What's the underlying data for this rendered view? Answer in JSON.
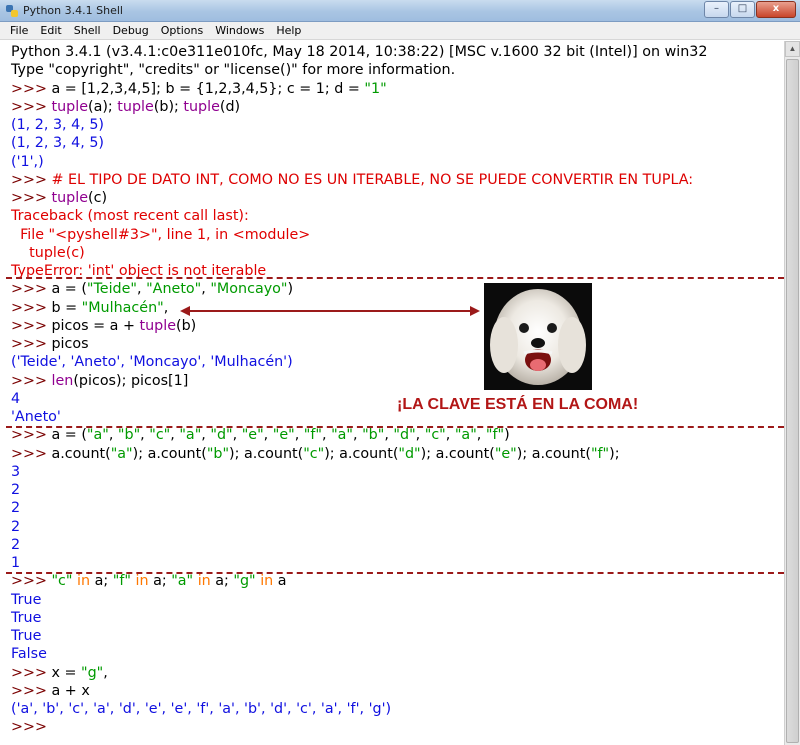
{
  "window": {
    "title": "Python 3.4.1 Shell",
    "buttons": {
      "minimize": "–",
      "maximize": "□",
      "close": "x"
    }
  },
  "menu": [
    "File",
    "Edit",
    "Shell",
    "Debug",
    "Options",
    "Windows",
    "Help"
  ],
  "annotation": "¡LA CLAVE ESTÁ EN LA COMA!",
  "photo_alt": "white dog",
  "colors": {
    "prompt": "#7a0000",
    "string": "#009a00",
    "builtin": "#900090",
    "output": "#1010e0",
    "error": "#e00000",
    "keyword": "#ff7700",
    "separator": "#9b1a1a"
  },
  "lines": [
    {
      "segs": [
        [
          "Python 3.4.1 (v3.4.1:c0e311e010fc, May 18 2014, 10:38:22) [MSC v.1600 32 bit (Intel)] on win32",
          ""
        ]
      ]
    },
    {
      "segs": [
        [
          "Type \"copyright\", \"credits\" or \"license()\" for more information.",
          ""
        ]
      ]
    },
    {
      "segs": [
        [
          ">>> ",
          "prompt"
        ],
        [
          "a = [1,2,3,4,5]; b = {1,2,3,4,5}; c = 1; d = ",
          ""
        ],
        [
          "\"1\"",
          "string"
        ]
      ]
    },
    {
      "segs": [
        [
          ">>> ",
          "prompt"
        ],
        [
          "tuple",
          "builtin"
        ],
        [
          "(a); ",
          ""
        ],
        [
          "tuple",
          "builtin"
        ],
        [
          "(b); ",
          ""
        ],
        [
          "tuple",
          "builtin"
        ],
        [
          "(d)",
          ""
        ]
      ]
    },
    {
      "segs": [
        [
          "(1, 2, 3, 4, 5)",
          "output"
        ]
      ]
    },
    {
      "segs": [
        [
          "(1, 2, 3, 4, 5)",
          "output"
        ]
      ]
    },
    {
      "segs": [
        [
          "('1',)",
          "output"
        ]
      ]
    },
    {
      "segs": [
        [
          ">>> ",
          "prompt"
        ],
        [
          "# EL TIPO DE DATO INT, COMO NO ES UN ITERABLE, NO SE PUEDE CONVERTIR EN TUPLA:",
          "comment"
        ]
      ]
    },
    {
      "segs": [
        [
          ">>> ",
          "prompt"
        ],
        [
          "tuple",
          "builtin"
        ],
        [
          "(c)",
          ""
        ]
      ]
    },
    {
      "segs": [
        [
          "Traceback (most recent call last):",
          "error"
        ]
      ]
    },
    {
      "segs": [
        [
          "  File \"<pyshell#3>\", line 1, in <module>",
          "error"
        ]
      ]
    },
    {
      "segs": [
        [
          "    tuple(c)",
          "error"
        ]
      ]
    },
    {
      "segs": [
        [
          "TypeError: 'int' object is not iterable",
          "error"
        ]
      ]
    },
    {
      "segs": [
        [
          ">>> ",
          "prompt"
        ],
        [
          "a = (",
          ""
        ],
        [
          "\"Teide\"",
          "string"
        ],
        [
          ", ",
          ""
        ],
        [
          "\"Aneto\"",
          "string"
        ],
        [
          ", ",
          ""
        ],
        [
          "\"Moncayo\"",
          "string"
        ],
        [
          ")",
          ""
        ]
      ]
    },
    {
      "segs": [
        [
          ">>> ",
          "prompt"
        ],
        [
          "b = ",
          ""
        ],
        [
          "\"Mulhacén\"",
          "string"
        ],
        [
          ",",
          ""
        ]
      ]
    },
    {
      "segs": [
        [
          ">>> ",
          "prompt"
        ],
        [
          "picos = a + ",
          ""
        ],
        [
          "tuple",
          "builtin"
        ],
        [
          "(b)",
          ""
        ]
      ]
    },
    {
      "segs": [
        [
          ">>> ",
          "prompt"
        ],
        [
          "picos",
          ""
        ]
      ]
    },
    {
      "segs": [
        [
          "('Teide', 'Aneto', 'Moncayo', 'Mulhacén')",
          "output"
        ]
      ]
    },
    {
      "segs": [
        [
          ">>> ",
          "prompt"
        ],
        [
          "len",
          "builtin"
        ],
        [
          "(picos); picos[1]",
          ""
        ]
      ]
    },
    {
      "segs": [
        [
          "4",
          "output"
        ]
      ]
    },
    {
      "segs": [
        [
          "'Aneto'",
          "output"
        ]
      ]
    },
    {
      "segs": [
        [
          ">>> ",
          "prompt"
        ],
        [
          "a = (",
          ""
        ],
        [
          "\"a\"",
          "string"
        ],
        [
          ", ",
          ""
        ],
        [
          "\"b\"",
          "string"
        ],
        [
          ", ",
          ""
        ],
        [
          "\"c\"",
          "string"
        ],
        [
          ", ",
          ""
        ],
        [
          "\"a\"",
          "string"
        ],
        [
          ", ",
          ""
        ],
        [
          "\"d\"",
          "string"
        ],
        [
          ", ",
          ""
        ],
        [
          "\"e\"",
          "string"
        ],
        [
          ", ",
          ""
        ],
        [
          "\"e\"",
          "string"
        ],
        [
          ", ",
          ""
        ],
        [
          "\"f\"",
          "string"
        ],
        [
          ", ",
          ""
        ],
        [
          "\"a\"",
          "string"
        ],
        [
          ", ",
          ""
        ],
        [
          "\"b\"",
          "string"
        ],
        [
          ", ",
          ""
        ],
        [
          "\"d\"",
          "string"
        ],
        [
          ", ",
          ""
        ],
        [
          "\"c\"",
          "string"
        ],
        [
          ", ",
          ""
        ],
        [
          "\"a\"",
          "string"
        ],
        [
          ", ",
          ""
        ],
        [
          "\"f\"",
          "string"
        ],
        [
          ")",
          ""
        ]
      ]
    },
    {
      "segs": [
        [
          ">>> ",
          "prompt"
        ],
        [
          "a.count(",
          ""
        ],
        [
          "\"a\"",
          "string"
        ],
        [
          "); a.count(",
          ""
        ],
        [
          "\"b\"",
          "string"
        ],
        [
          "); a.count(",
          ""
        ],
        [
          "\"c\"",
          "string"
        ],
        [
          "); a.count(",
          ""
        ],
        [
          "\"d\"",
          "string"
        ],
        [
          "); a.count(",
          ""
        ],
        [
          "\"e\"",
          "string"
        ],
        [
          "); a.count(",
          ""
        ],
        [
          "\"f\"",
          "string"
        ],
        [
          ");",
          ""
        ]
      ]
    },
    {
      "segs": [
        [
          "3",
          "output"
        ]
      ]
    },
    {
      "segs": [
        [
          "2",
          "output"
        ]
      ]
    },
    {
      "segs": [
        [
          "2",
          "output"
        ]
      ]
    },
    {
      "segs": [
        [
          "2",
          "output"
        ]
      ]
    },
    {
      "segs": [
        [
          "2",
          "output"
        ]
      ]
    },
    {
      "segs": [
        [
          "1",
          "output"
        ]
      ]
    },
    {
      "segs": [
        [
          ">>> ",
          "prompt"
        ],
        [
          "\"c\"",
          "string"
        ],
        [
          " ",
          ""
        ],
        [
          "in",
          "keyword"
        ],
        [
          " a; ",
          ""
        ],
        [
          "\"f\"",
          "string"
        ],
        [
          " ",
          ""
        ],
        [
          "in",
          "keyword"
        ],
        [
          " a; ",
          ""
        ],
        [
          "\"a\"",
          "string"
        ],
        [
          " ",
          ""
        ],
        [
          "in",
          "keyword"
        ],
        [
          " a; ",
          ""
        ],
        [
          "\"g\"",
          "string"
        ],
        [
          " ",
          ""
        ],
        [
          "in",
          "keyword"
        ],
        [
          " a",
          ""
        ]
      ]
    },
    {
      "segs": [
        [
          "True",
          "output"
        ]
      ]
    },
    {
      "segs": [
        [
          "True",
          "output"
        ]
      ]
    },
    {
      "segs": [
        [
          "True",
          "output"
        ]
      ]
    },
    {
      "segs": [
        [
          "False",
          "output"
        ]
      ]
    },
    {
      "segs": [
        [
          ">>> ",
          "prompt"
        ],
        [
          "x = ",
          ""
        ],
        [
          "\"g\"",
          "string"
        ],
        [
          ",",
          ""
        ]
      ]
    },
    {
      "segs": [
        [
          ">>> ",
          "prompt"
        ],
        [
          "a + x",
          ""
        ]
      ]
    },
    {
      "segs": [
        [
          "('a', 'b', 'c', 'a', 'd', 'e', 'e', 'f', 'a', 'b', 'd', 'c', 'a', 'f', 'g')",
          "output"
        ]
      ]
    },
    {
      "segs": [
        [
          ">>> ",
          "prompt"
        ]
      ]
    }
  ]
}
